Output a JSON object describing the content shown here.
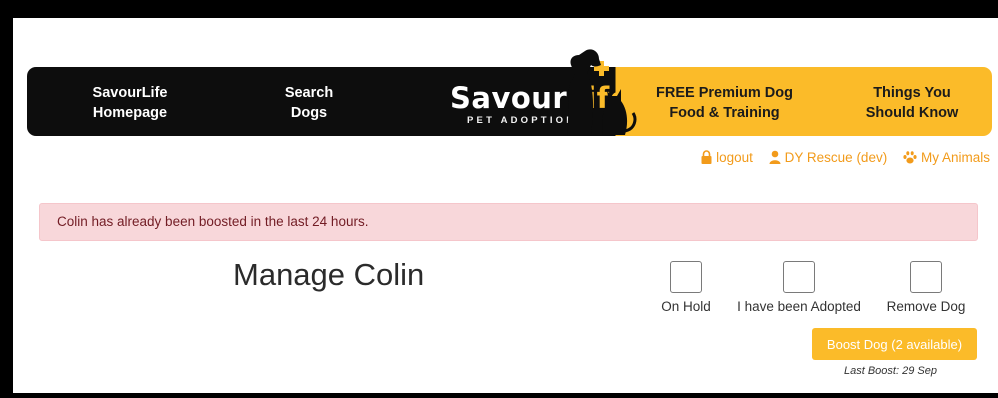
{
  "nav": {
    "homepage_line1": "SavourLife",
    "homepage_line2": "Homepage",
    "search_line1": "Search",
    "search_line2": "Dogs",
    "logo_word1": "Savour",
    "logo_word2": "Life",
    "logo_sub": "PET ADOPTIONS",
    "free_line1": "FREE Premium Dog",
    "free_line2": "Food & Training",
    "things_line1": "Things You",
    "things_line2": "Should Know"
  },
  "user": {
    "logout": "logout",
    "rescue": "DY Rescue (dev)",
    "animals": "My Animals"
  },
  "alert": {
    "message": "Colin has already been boosted in the last 24 hours."
  },
  "main": {
    "title": "Manage Colin",
    "checkboxes": [
      {
        "label": "On Hold",
        "checked": false
      },
      {
        "label": "I have been Adopted",
        "checked": false
      },
      {
        "label": "Remove Dog",
        "checked": false
      }
    ],
    "boost_label": "Boost Dog (2 available)",
    "last_boost": "Last Boost: 29 Sep"
  },
  "colors": {
    "brand_yellow": "#fbbb29",
    "brand_dark": "#0d0d0d",
    "link_orange": "#f29b1b",
    "alert_bg": "#f8d7da",
    "alert_text": "#721c24"
  },
  "icons": [
    "lock-icon",
    "user-icon",
    "paw-icon",
    "dog-cat-silhouette-icon"
  ]
}
